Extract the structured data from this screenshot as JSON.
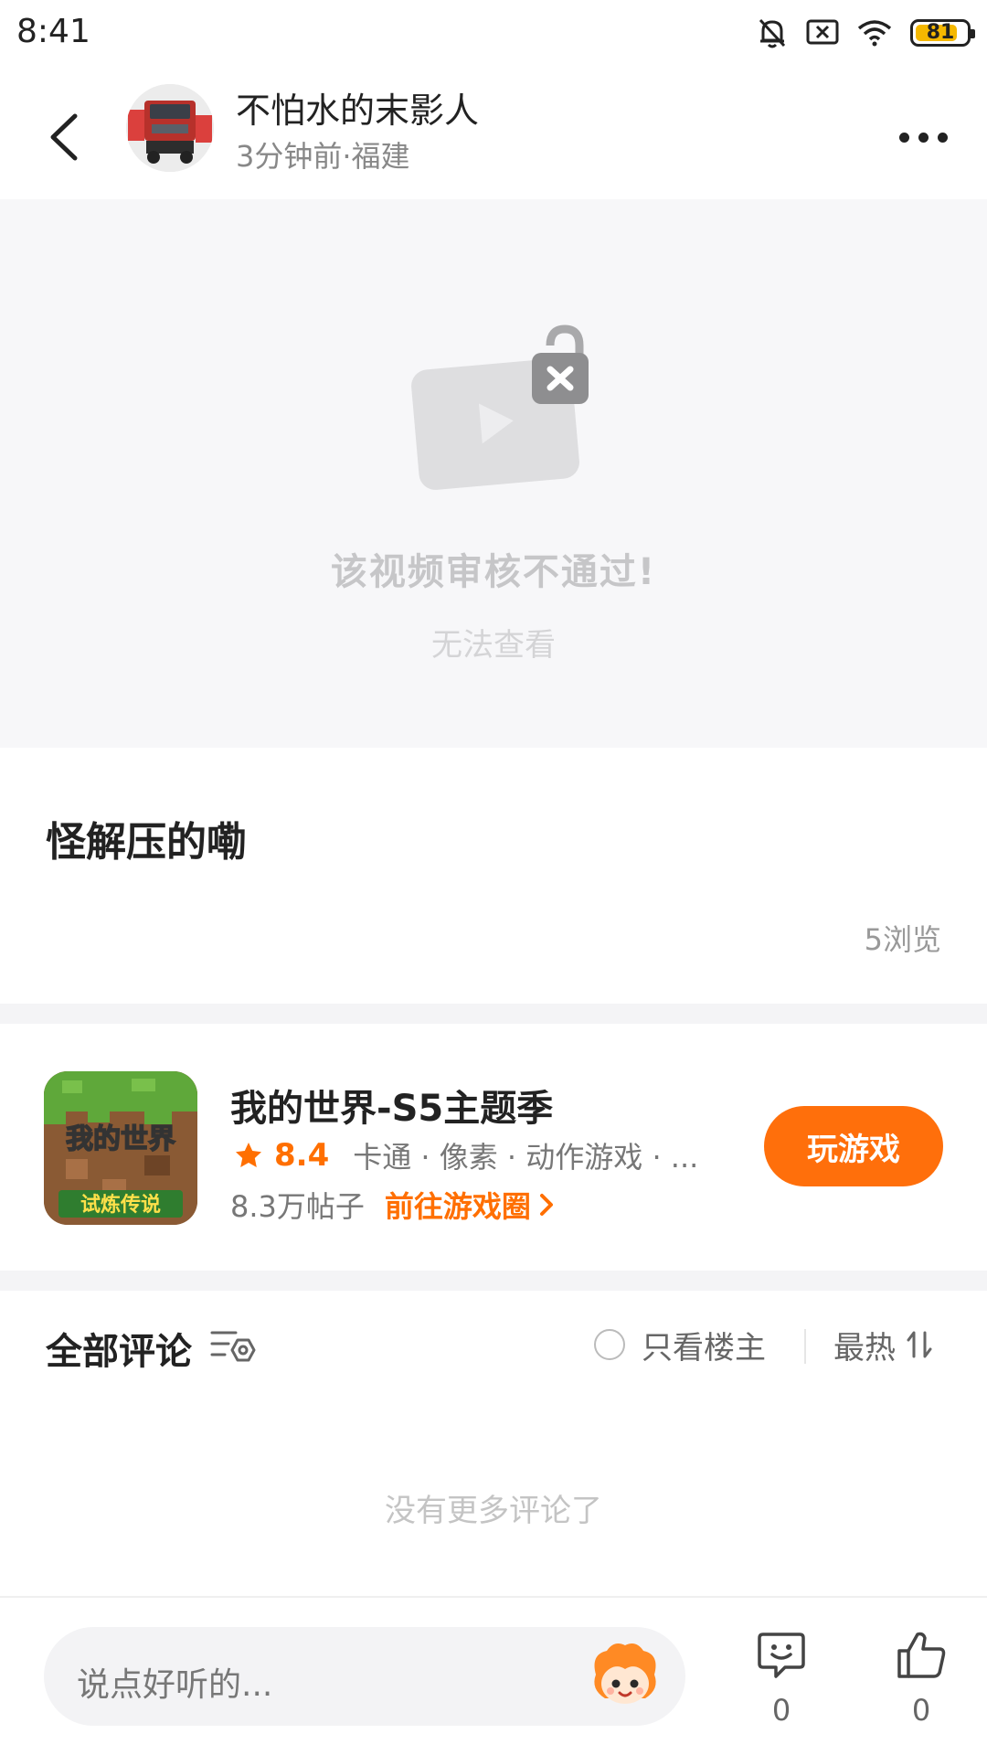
{
  "status_bar": {
    "time": "8:41",
    "battery": "81"
  },
  "header": {
    "author_name": "不怕水的末影人",
    "post_meta": "3分钟前·福建"
  },
  "video": {
    "blocked_title": "该视频审核不通过!",
    "blocked_subtitle": "无法查看"
  },
  "post": {
    "title": "怪解压的嘞",
    "views": "5浏览"
  },
  "game": {
    "name": "我的世界-S5主题季",
    "rating": "8.4",
    "tags": "卡通 · 像素 · 动作游戏 · ...",
    "posts": "8.3万帖子",
    "circle_link": "前往游戏圈",
    "play_label": "玩游戏",
    "icon_text_top": "我的世界",
    "icon_text_bottom": "试炼传说"
  },
  "comments": {
    "title": "全部评论",
    "owner_only_label": "只看楼主",
    "sort_label": "最热",
    "empty_text": "没有更多评论了"
  },
  "bottom_bar": {
    "input_placeholder": "说点好听的...",
    "comment_count": "0",
    "like_count": "0"
  },
  "colors": {
    "accent": "#ff6f0b",
    "rating": "#ff6f00"
  },
  "icons": {
    "back": "chevron-left-icon",
    "more": "more-dots-icon",
    "blocked": "locked-video-icon",
    "star": "star-icon",
    "arrow": "chevron-right-icon",
    "filter": "filter-icon",
    "sort": "sort-icon",
    "comment": "comment-icon",
    "like": "thumbs-up-icon",
    "mute": "bell-off-icon",
    "wifi": "wifi-icon"
  }
}
